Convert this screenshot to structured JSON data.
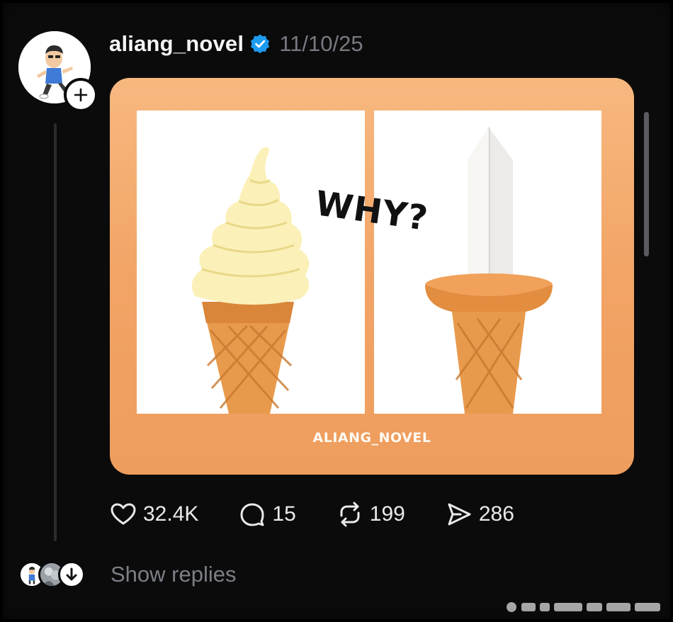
{
  "post": {
    "username": "aliang_novel",
    "timestamp": "11/10/25",
    "verified": true,
    "image": {
      "overlay_text": "WHY?",
      "watermark": "ALIANG_NOVEL"
    },
    "stats": {
      "likes": "32.4K",
      "comments": "15",
      "reposts": "199",
      "shares": "286"
    }
  },
  "replies": {
    "label": "Show replies"
  },
  "icons": {
    "like": "heart-icon",
    "comment": "comment-bubble-icon",
    "repost": "repost-icon",
    "share": "send-icon",
    "follow": "plus-icon",
    "verified": "verified-badge-icon",
    "expand": "arrow-down-icon"
  },
  "colors": {
    "background": "#0b0b0c",
    "verified": "#1d9bf0",
    "card_orange": "#f2a466",
    "muted_text": "#777a80"
  }
}
